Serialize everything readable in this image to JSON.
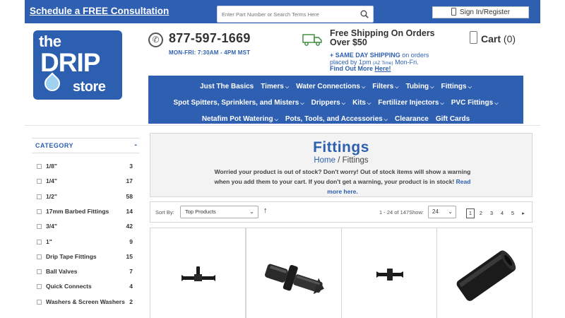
{
  "topbar": {
    "consult_link": "Schedule a FREE Consultation",
    "search_placeholder": "Enter Part Number or Search Terms Here",
    "signin_label": "Sign In/Register"
  },
  "header": {
    "logo_the": "the",
    "logo_drip": "DRIP",
    "logo_store": "store",
    "phone": "877-597-1669",
    "hours": "MON-FRI: 7:30AM - 4PM MST",
    "shipping_title": "Free Shipping On Orders Over $50",
    "same_day": "+ SAME DAY SHIPPING",
    "same_day_rest": " on orders placed by 1pm ",
    "az_time": "(AZ Time)",
    "same_day_end": " Mon-Fri.",
    "find_out": "Find Out More ",
    "find_out_link": "Here!",
    "cart_label": "Cart",
    "cart_count": "(0)"
  },
  "nav": {
    "row1": [
      "Just The Basics",
      "Timers",
      "Water Connections",
      "Filters",
      "Tubing",
      "Fittings"
    ],
    "row1_chevron": [
      false,
      true,
      true,
      true,
      true,
      true
    ],
    "row2": [
      "Spot Spitters, Sprinklers, and Misters",
      "Drippers",
      "Kits",
      "Fertilizer Injectors",
      "PVC Fittings"
    ],
    "row2_chevron": [
      true,
      true,
      true,
      true,
      true
    ],
    "row3": [
      "Netafim Pot Watering",
      "Pots, Tools, and Accessories",
      "Clearance",
      "Gift Cards"
    ],
    "row3_chevron": [
      true,
      true,
      false,
      false
    ]
  },
  "sidebar": {
    "heading": "CATEGORY",
    "collapse": "-",
    "items": [
      {
        "label": "1/8\"",
        "count": "3"
      },
      {
        "label": "1/4\"",
        "count": "17"
      },
      {
        "label": "1/2\"",
        "count": "58"
      },
      {
        "label": "17mm Barbed Fittings",
        "count": "14"
      },
      {
        "label": "3/4\"",
        "count": "42"
      },
      {
        "label": "1\"",
        "count": "9"
      },
      {
        "label": "Drip Tape Fittings",
        "count": "15"
      },
      {
        "label": "Ball Valves",
        "count": "7"
      },
      {
        "label": "Quick Connects",
        "count": "4"
      },
      {
        "label": "Washers & Screen Washers",
        "count": "2"
      }
    ]
  },
  "main": {
    "title": "Fittings",
    "breadcrumb_home": "Home",
    "breadcrumb_sep": "/",
    "breadcrumb_current": "Fittings",
    "notice": "Worried your product is out of stock? Don't worry! Out of stock items will show a warning when you add them to your cart. If you don't get a warning, your product is in stock! ",
    "read_more": "Read more here."
  },
  "toolbar": {
    "sort_label": "Sort By:",
    "sort_value": "Top Products",
    "range_text": "1 - 24 of 147",
    "show_label": "Show:",
    "show_value": "24",
    "pages": [
      "1",
      "2",
      "3",
      "4",
      "5"
    ],
    "next_symbol": "▸"
  },
  "products": [
    "tee-barb-fitting",
    "barbed-coupling",
    "small-barb-connector",
    "black-tube-coupling"
  ],
  "colors": {
    "brand_blue": "#2f5fb0",
    "panel_gray": "#f3f3f3"
  }
}
